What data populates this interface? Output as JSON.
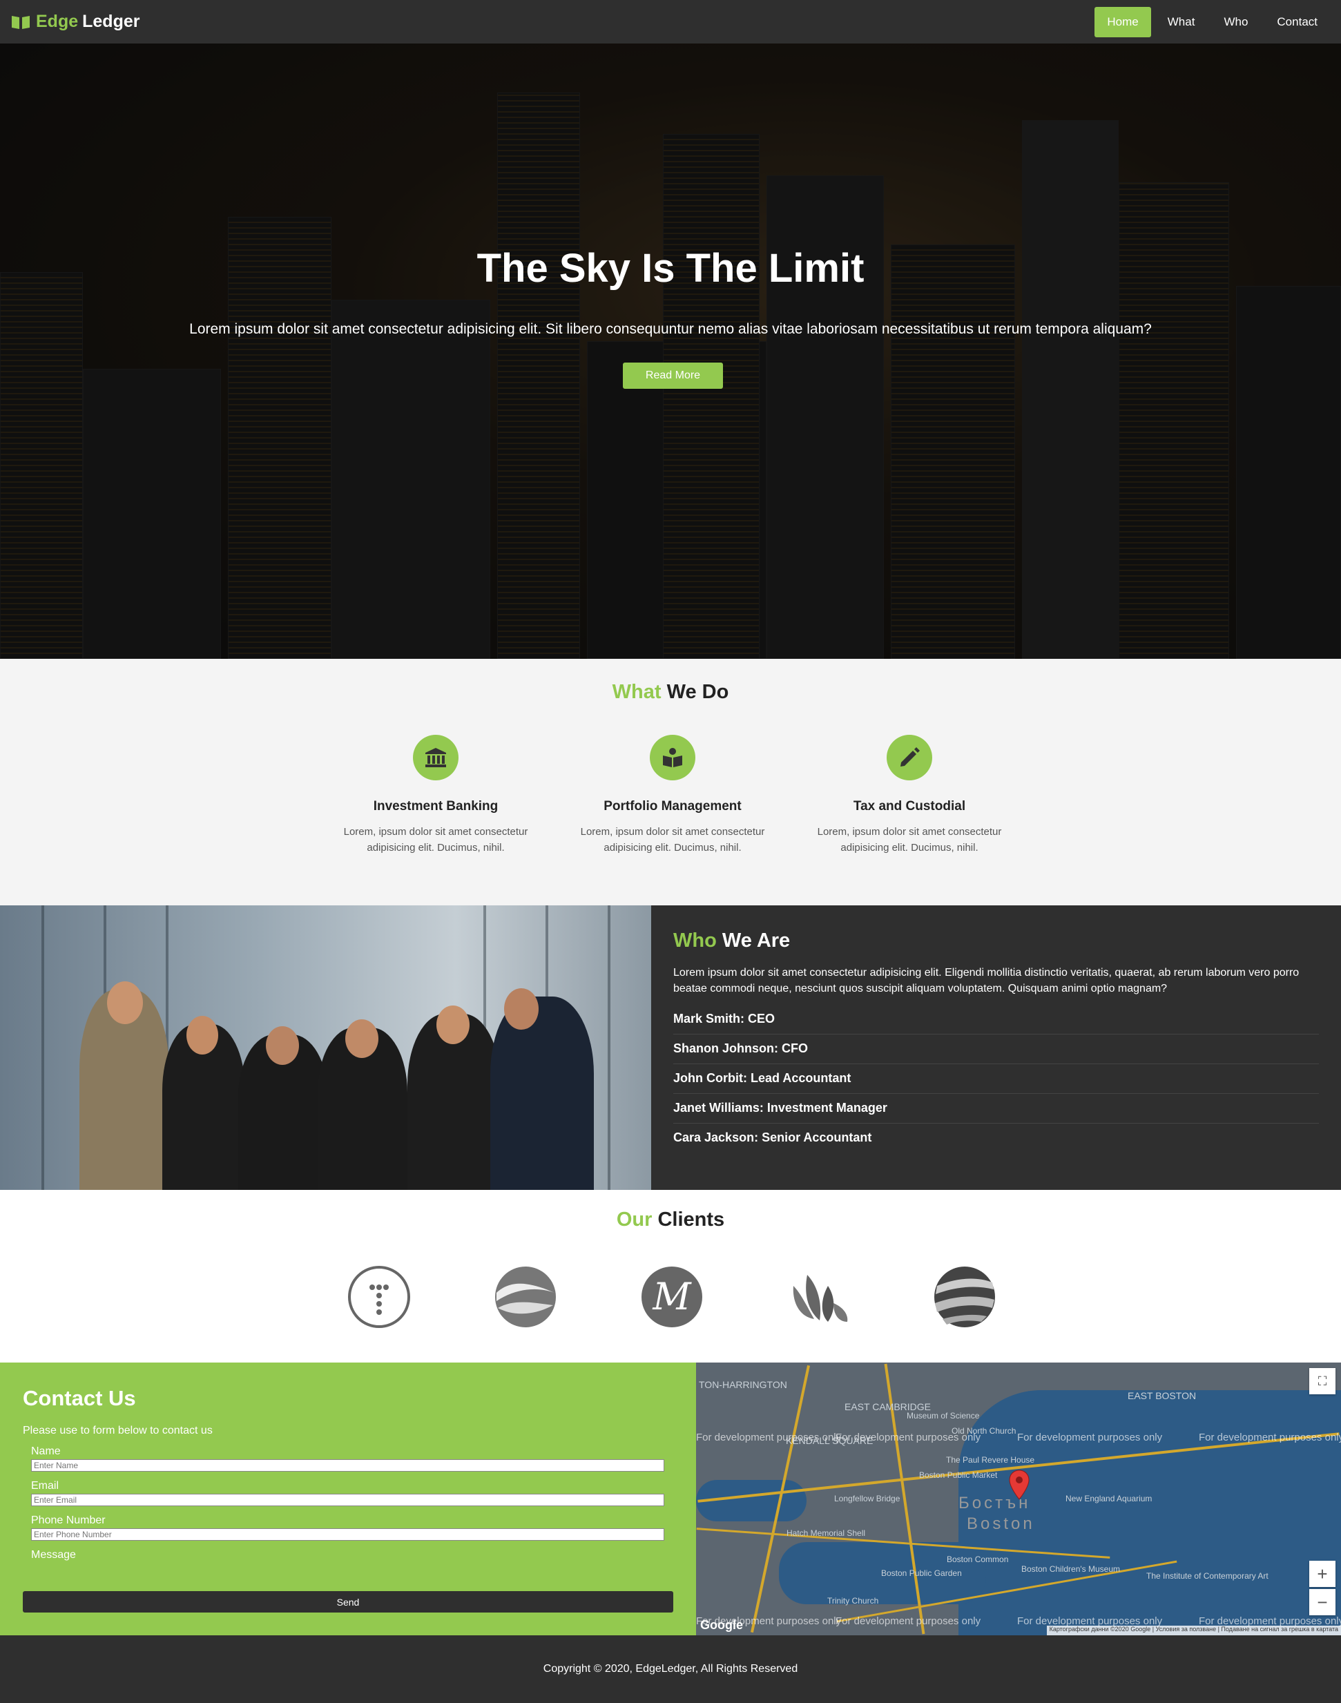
{
  "nav": {
    "brand_part1": "Edge",
    "brand_part2": "Ledger",
    "links": [
      "Home",
      "What",
      "Who",
      "Contact"
    ],
    "active": "Home"
  },
  "hero": {
    "title": "The Sky Is The Limit",
    "text": "Lorem ipsum dolor sit amet consectetur adipisicing elit. Sit libero consequuntur nemo alias vitae laboriosam necessitatibus ut rerum tempora aliquam?",
    "button": "Read More"
  },
  "what": {
    "title_accent": "What",
    "title_rest": "We Do",
    "services": [
      {
        "icon": "bank-icon",
        "title": "Investment Banking",
        "text": "Lorem, ipsum dolor sit amet consectetur adipisicing elit. Ducimus, nihil."
      },
      {
        "icon": "book-reader-icon",
        "title": "Portfolio Management",
        "text": "Lorem, ipsum dolor sit amet consectetur adipisicing elit. Ducimus, nihil."
      },
      {
        "icon": "pencil-icon",
        "title": "Tax and Custodial",
        "text": "Lorem, ipsum dolor sit amet consectetur adipisicing elit. Ducimus, nihil."
      }
    ]
  },
  "who": {
    "title_accent": "Who",
    "title_rest": "We Are",
    "text": "Lorem ipsum dolor sit amet consectetur adipisicing elit. Eligendi mollitia distinctio veritatis, quaerat, ab rerum laborum vero porro beatae commodi neque, nesciunt quos suscipit aliquam voluptatem. Quisquam animi optio magnam?",
    "team": [
      "Mark Smith: CEO",
      "Shanon Johnson: CFO",
      "John Corbit: Lead Accountant",
      "Janet Williams: Investment Manager",
      "Cara Jackson: Senior Accountant"
    ]
  },
  "clients": {
    "title_accent": "Our",
    "title_rest": "Clients"
  },
  "contact": {
    "title": "Contact Us",
    "subtitle": "Please use to form below to contact us",
    "name_label": "Name",
    "name_placeholder": "Enter Name",
    "email_label": "Email",
    "email_placeholder": "Enter Email",
    "phone_label": "Phone Number",
    "phone_placeholder": "Enter Phone Number",
    "message_label": "Message",
    "send": "Send"
  },
  "map": {
    "dev_text": "For development purposes only",
    "labels": [
      "TON-HARRINGTON",
      "EAST CAMBRIDGE",
      "EAST BOSTON",
      "Museum of Science",
      "Old North Church",
      "The Paul Revere House",
      "Boston Public Market",
      "Longfellow Bridge",
      "New England Aquarium",
      "Hatch Memorial Shell",
      "Boston Common",
      "Boston Public Garden",
      "Boston Children's Museum",
      "The Institute of Contemporary Art",
      "Trinity Church",
      "Бостън",
      "Boston",
      "KENDALL SQUARE"
    ],
    "attribution": "Картографски данни ©2020 Google | Условия за ползване | Подаване на сигнал за грешка в картата",
    "logo": "Google",
    "zoom_in": "+",
    "zoom_out": "−"
  },
  "footer": {
    "text": "Copyright © 2020, EdgeLedger, All Rights Reserved"
  },
  "colors": {
    "accent": "#93c94f",
    "dark": "#2f2f2f",
    "light": "#f4f4f4"
  }
}
